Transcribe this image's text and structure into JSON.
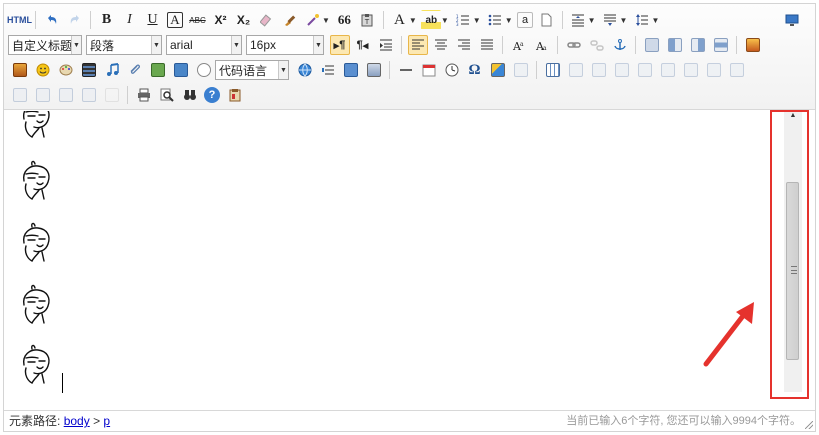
{
  "toolbar": {
    "html_label": "HTML",
    "bold": "B",
    "italic": "I",
    "underline": "U",
    "font_border": "A",
    "strike": "ABC",
    "superscript": "X²",
    "subscript": "X₂",
    "quote": "66",
    "fontcolor": "A",
    "backcolor": "ab",
    "source_marker": "a",
    "ltr": "¶",
    "rtl": "¶",
    "omega": "Ω",
    "help": "?",
    "heading_select": "自定义标题",
    "paragraph_select": "段落",
    "font_select": "arial",
    "size_select": "16px",
    "code_select": "代码语言"
  },
  "content": {
    "emoji_count": 5
  },
  "statusbar": {
    "path_label": "元素路径:",
    "path_body": "body",
    "path_sep": ">",
    "path_p": "p",
    "counter": "当前已输入6个字符, 您还可以输入9994个字符。"
  },
  "colors": {
    "highlight_box": "#e5322d",
    "arrow": "#e5322d",
    "active_button": "#fce8b2"
  }
}
